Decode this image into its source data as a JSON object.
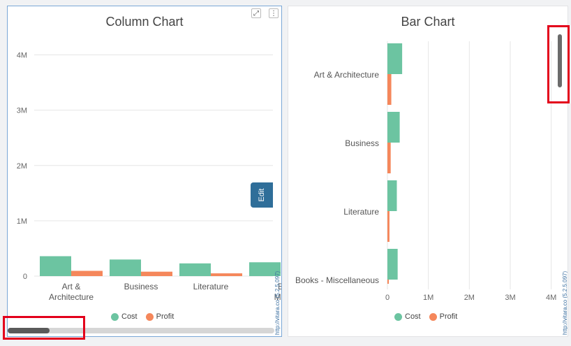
{
  "colors": {
    "cost": "#6cc4a1",
    "profit": "#f5875b",
    "grid": "#e6e6e6",
    "highlight": "#e3001b",
    "edit": "#2f6e99"
  },
  "icons": {
    "expand": "expand-icon",
    "menu": "kebab-menu-icon"
  },
  "left_panel": {
    "title": "Column Chart",
    "edit_label": "Edit",
    "watermark": "http://vitara.co (5.2.5.097)",
    "scroll_position": 0.0
  },
  "right_panel": {
    "title": "Bar Chart",
    "watermark": "http://vitara.co (5.2.5.097)",
    "scroll_position": 0.0
  },
  "chart_data": [
    {
      "type": "bar",
      "orientation": "vertical",
      "title": "Column Chart",
      "categories": [
        "Art & Architecture",
        "Business",
        "Literature",
        "Books - Miscellaneous"
      ],
      "visible_category_labels": [
        "Art &\nArchitecture",
        "Business",
        "Literature",
        "B\nMis"
      ],
      "series": [
        {
          "name": "Cost",
          "values": [
            360000,
            300000,
            230000,
            250000
          ]
        },
        {
          "name": "Profit",
          "values": [
            95000,
            80000,
            50000,
            0
          ]
        }
      ],
      "ylim": [
        0,
        4500000
      ],
      "y_ticks": [
        0,
        1000000,
        2000000,
        3000000,
        4000000
      ],
      "y_tick_labels": [
        "0",
        "1M",
        "2M",
        "3M",
        "4M"
      ],
      "grid": true,
      "legend": "bottom-center"
    },
    {
      "type": "bar",
      "orientation": "horizontal",
      "title": "Bar Chart",
      "categories": [
        "Art & Architecture",
        "Business",
        "Literature",
        "Books - Miscellaneous"
      ],
      "series": [
        {
          "name": "Cost",
          "values": [
            360000,
            300000,
            230000,
            250000
          ]
        },
        {
          "name": "Profit",
          "values": [
            95000,
            80000,
            50000,
            30000
          ]
        }
      ],
      "xlim": [
        0,
        4500000
      ],
      "x_ticks": [
        0,
        1000000,
        2000000,
        3000000,
        4000000
      ],
      "x_tick_labels": [
        "0",
        "1M",
        "2M",
        "3M",
        "4M"
      ],
      "grid": true,
      "legend": "bottom-center"
    }
  ]
}
